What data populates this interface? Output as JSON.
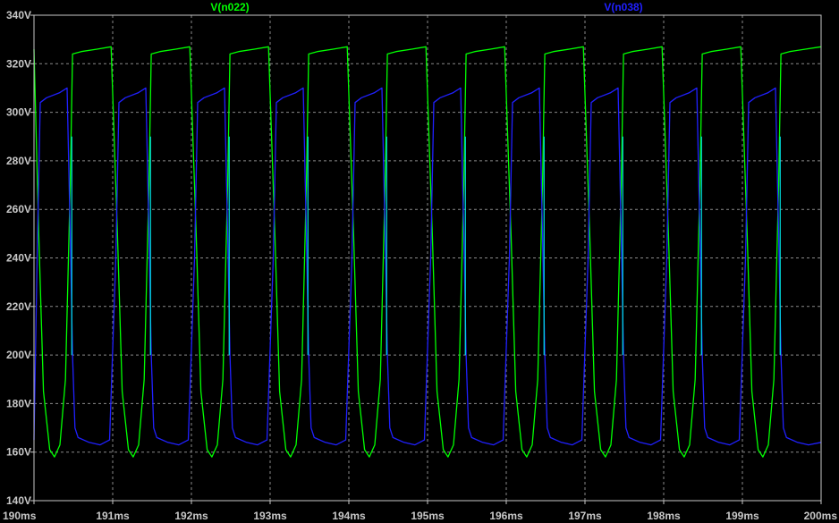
{
  "chart_data": {
    "type": "line",
    "title": "",
    "xlabel": "",
    "ylabel": "",
    "xlim": [
      190,
      200
    ],
    "ylim": [
      140,
      340
    ],
    "grid": true,
    "x_ticks": [
      "190ms",
      "191ms",
      "192ms",
      "193ms",
      "194ms",
      "195ms",
      "196ms",
      "197ms",
      "198ms",
      "199ms",
      "200ms"
    ],
    "y_ticks": [
      "140V",
      "160V",
      "180V",
      "200V",
      "220V",
      "240V",
      "260V",
      "280V",
      "300V",
      "320V",
      "340V"
    ],
    "series": [
      {
        "name": "V(n022)",
        "color": "#00ff00",
        "points": [
          [
            190.0,
            326
          ],
          [
            190.06,
            250
          ],
          [
            190.12,
            185
          ],
          [
            190.2,
            161
          ],
          [
            190.26,
            158
          ],
          [
            190.33,
            163
          ],
          [
            190.4,
            190
          ],
          [
            190.46,
            270
          ],
          [
            190.49,
            324
          ],
          [
            190.6,
            325
          ],
          [
            190.8,
            326
          ],
          [
            190.98,
            327
          ],
          [
            191.06,
            250
          ],
          [
            191.12,
            185
          ],
          [
            191.2,
            161
          ],
          [
            191.26,
            158
          ],
          [
            191.33,
            163
          ],
          [
            191.4,
            190
          ],
          [
            191.46,
            270
          ],
          [
            191.49,
            324
          ],
          [
            191.6,
            325
          ],
          [
            191.8,
            326
          ],
          [
            191.98,
            327
          ],
          [
            192.06,
            250
          ],
          [
            192.12,
            185
          ],
          [
            192.2,
            161
          ],
          [
            192.26,
            158
          ],
          [
            192.33,
            163
          ],
          [
            192.4,
            190
          ],
          [
            192.46,
            270
          ],
          [
            192.49,
            324
          ],
          [
            192.6,
            325
          ],
          [
            192.8,
            326
          ],
          [
            192.98,
            327
          ],
          [
            193.06,
            250
          ],
          [
            193.12,
            185
          ],
          [
            193.2,
            161
          ],
          [
            193.26,
            158
          ],
          [
            193.33,
            163
          ],
          [
            193.4,
            190
          ],
          [
            193.46,
            270
          ],
          [
            193.49,
            324
          ],
          [
            193.6,
            325
          ],
          [
            193.8,
            326
          ],
          [
            193.98,
            327
          ],
          [
            194.06,
            250
          ],
          [
            194.12,
            185
          ],
          [
            194.2,
            161
          ],
          [
            194.26,
            158
          ],
          [
            194.33,
            163
          ],
          [
            194.4,
            190
          ],
          [
            194.46,
            270
          ],
          [
            194.49,
            324
          ],
          [
            194.6,
            325
          ],
          [
            194.8,
            326
          ],
          [
            194.98,
            327
          ],
          [
            195.06,
            250
          ],
          [
            195.12,
            185
          ],
          [
            195.2,
            161
          ],
          [
            195.26,
            158
          ],
          [
            195.33,
            163
          ],
          [
            195.4,
            190
          ],
          [
            195.46,
            270
          ],
          [
            195.49,
            324
          ],
          [
            195.6,
            325
          ],
          [
            195.8,
            326
          ],
          [
            195.98,
            327
          ],
          [
            196.06,
            250
          ],
          [
            196.12,
            185
          ],
          [
            196.2,
            161
          ],
          [
            196.26,
            158
          ],
          [
            196.33,
            163
          ],
          [
            196.4,
            190
          ],
          [
            196.46,
            270
          ],
          [
            196.49,
            324
          ],
          [
            196.6,
            325
          ],
          [
            196.8,
            326
          ],
          [
            196.98,
            327
          ],
          [
            197.06,
            250
          ],
          [
            197.12,
            185
          ],
          [
            197.2,
            161
          ],
          [
            197.26,
            158
          ],
          [
            197.33,
            163
          ],
          [
            197.4,
            190
          ],
          [
            197.46,
            270
          ],
          [
            197.49,
            324
          ],
          [
            197.6,
            325
          ],
          [
            197.8,
            326
          ],
          [
            197.98,
            327
          ],
          [
            198.06,
            250
          ],
          [
            198.12,
            185
          ],
          [
            198.2,
            161
          ],
          [
            198.26,
            158
          ],
          [
            198.33,
            163
          ],
          [
            198.4,
            190
          ],
          [
            198.46,
            270
          ],
          [
            198.49,
            324
          ],
          [
            198.6,
            325
          ],
          [
            198.8,
            326
          ],
          [
            198.98,
            327
          ],
          [
            199.06,
            250
          ],
          [
            199.12,
            185
          ],
          [
            199.2,
            161
          ],
          [
            199.26,
            158
          ],
          [
            199.33,
            163
          ],
          [
            199.4,
            190
          ],
          [
            199.46,
            270
          ],
          [
            199.49,
            324
          ],
          [
            199.6,
            325
          ],
          [
            199.8,
            326
          ],
          [
            200.0,
            327
          ]
        ]
      },
      {
        "name": "V(n038)",
        "color": "#2020ff",
        "points": [
          [
            190.0,
            165
          ],
          [
            190.04,
            240
          ],
          [
            190.08,
            304
          ],
          [
            190.16,
            306
          ],
          [
            190.32,
            308
          ],
          [
            190.42,
            310
          ],
          [
            190.46,
            250
          ],
          [
            190.49,
            200
          ],
          [
            190.52,
            170
          ],
          [
            190.56,
            166
          ],
          [
            190.7,
            164
          ],
          [
            190.84,
            163
          ],
          [
            190.96,
            165
          ],
          [
            191.04,
            240
          ],
          [
            191.08,
            304
          ],
          [
            191.16,
            306
          ],
          [
            191.32,
            308
          ],
          [
            191.42,
            310
          ],
          [
            191.46,
            250
          ],
          [
            191.49,
            200
          ],
          [
            191.52,
            170
          ],
          [
            191.56,
            166
          ],
          [
            191.7,
            164
          ],
          [
            191.84,
            163
          ],
          [
            191.96,
            165
          ],
          [
            192.04,
            240
          ],
          [
            192.08,
            304
          ],
          [
            192.16,
            306
          ],
          [
            192.32,
            308
          ],
          [
            192.42,
            310
          ],
          [
            192.46,
            250
          ],
          [
            192.49,
            200
          ],
          [
            192.52,
            170
          ],
          [
            192.56,
            166
          ],
          [
            192.7,
            164
          ],
          [
            192.84,
            163
          ],
          [
            192.96,
            165
          ],
          [
            193.04,
            240
          ],
          [
            193.08,
            304
          ],
          [
            193.16,
            306
          ],
          [
            193.32,
            308
          ],
          [
            193.42,
            310
          ],
          [
            193.46,
            250
          ],
          [
            193.49,
            200
          ],
          [
            193.52,
            170
          ],
          [
            193.56,
            166
          ],
          [
            193.7,
            164
          ],
          [
            193.84,
            163
          ],
          [
            193.96,
            165
          ],
          [
            194.04,
            240
          ],
          [
            194.08,
            304
          ],
          [
            194.16,
            306
          ],
          [
            194.32,
            308
          ],
          [
            194.42,
            310
          ],
          [
            194.46,
            250
          ],
          [
            194.49,
            200
          ],
          [
            194.52,
            170
          ],
          [
            194.56,
            166
          ],
          [
            194.7,
            164
          ],
          [
            194.84,
            163
          ],
          [
            194.96,
            165
          ],
          [
            195.04,
            240
          ],
          [
            195.08,
            304
          ],
          [
            195.16,
            306
          ],
          [
            195.32,
            308
          ],
          [
            195.42,
            310
          ],
          [
            195.46,
            250
          ],
          [
            195.49,
            200
          ],
          [
            195.52,
            170
          ],
          [
            195.56,
            166
          ],
          [
            195.7,
            164
          ],
          [
            195.84,
            163
          ],
          [
            195.96,
            165
          ],
          [
            196.04,
            240
          ],
          [
            196.08,
            304
          ],
          [
            196.16,
            306
          ],
          [
            196.32,
            308
          ],
          [
            196.42,
            310
          ],
          [
            196.46,
            250
          ],
          [
            196.49,
            200
          ],
          [
            196.52,
            170
          ],
          [
            196.56,
            166
          ],
          [
            196.7,
            164
          ],
          [
            196.84,
            163
          ],
          [
            196.96,
            165
          ],
          [
            197.04,
            240
          ],
          [
            197.08,
            304
          ],
          [
            197.16,
            306
          ],
          [
            197.32,
            308
          ],
          [
            197.42,
            310
          ],
          [
            197.46,
            250
          ],
          [
            197.49,
            200
          ],
          [
            197.52,
            170
          ],
          [
            197.56,
            166
          ],
          [
            197.7,
            164
          ],
          [
            197.84,
            163
          ],
          [
            197.96,
            165
          ],
          [
            198.04,
            240
          ],
          [
            198.08,
            304
          ],
          [
            198.16,
            306
          ],
          [
            198.32,
            308
          ],
          [
            198.42,
            310
          ],
          [
            198.46,
            250
          ],
          [
            198.49,
            200
          ],
          [
            198.52,
            170
          ],
          [
            198.56,
            166
          ],
          [
            198.7,
            164
          ],
          [
            198.84,
            163
          ],
          [
            198.96,
            165
          ],
          [
            199.04,
            240
          ],
          [
            199.08,
            304
          ],
          [
            199.16,
            306
          ],
          [
            199.32,
            308
          ],
          [
            199.42,
            310
          ],
          [
            199.46,
            250
          ],
          [
            199.49,
            200
          ],
          [
            199.52,
            170
          ],
          [
            199.56,
            166
          ],
          [
            199.7,
            164
          ],
          [
            199.84,
            163
          ],
          [
            200.0,
            164
          ]
        ]
      }
    ]
  },
  "style": {
    "background": "#000000",
    "grid_color": "#8a8a8a",
    "axis_color": "#c8c8c8",
    "tick_label_color": "#c8c8c8",
    "crossover_color": "#00e5e5"
  }
}
